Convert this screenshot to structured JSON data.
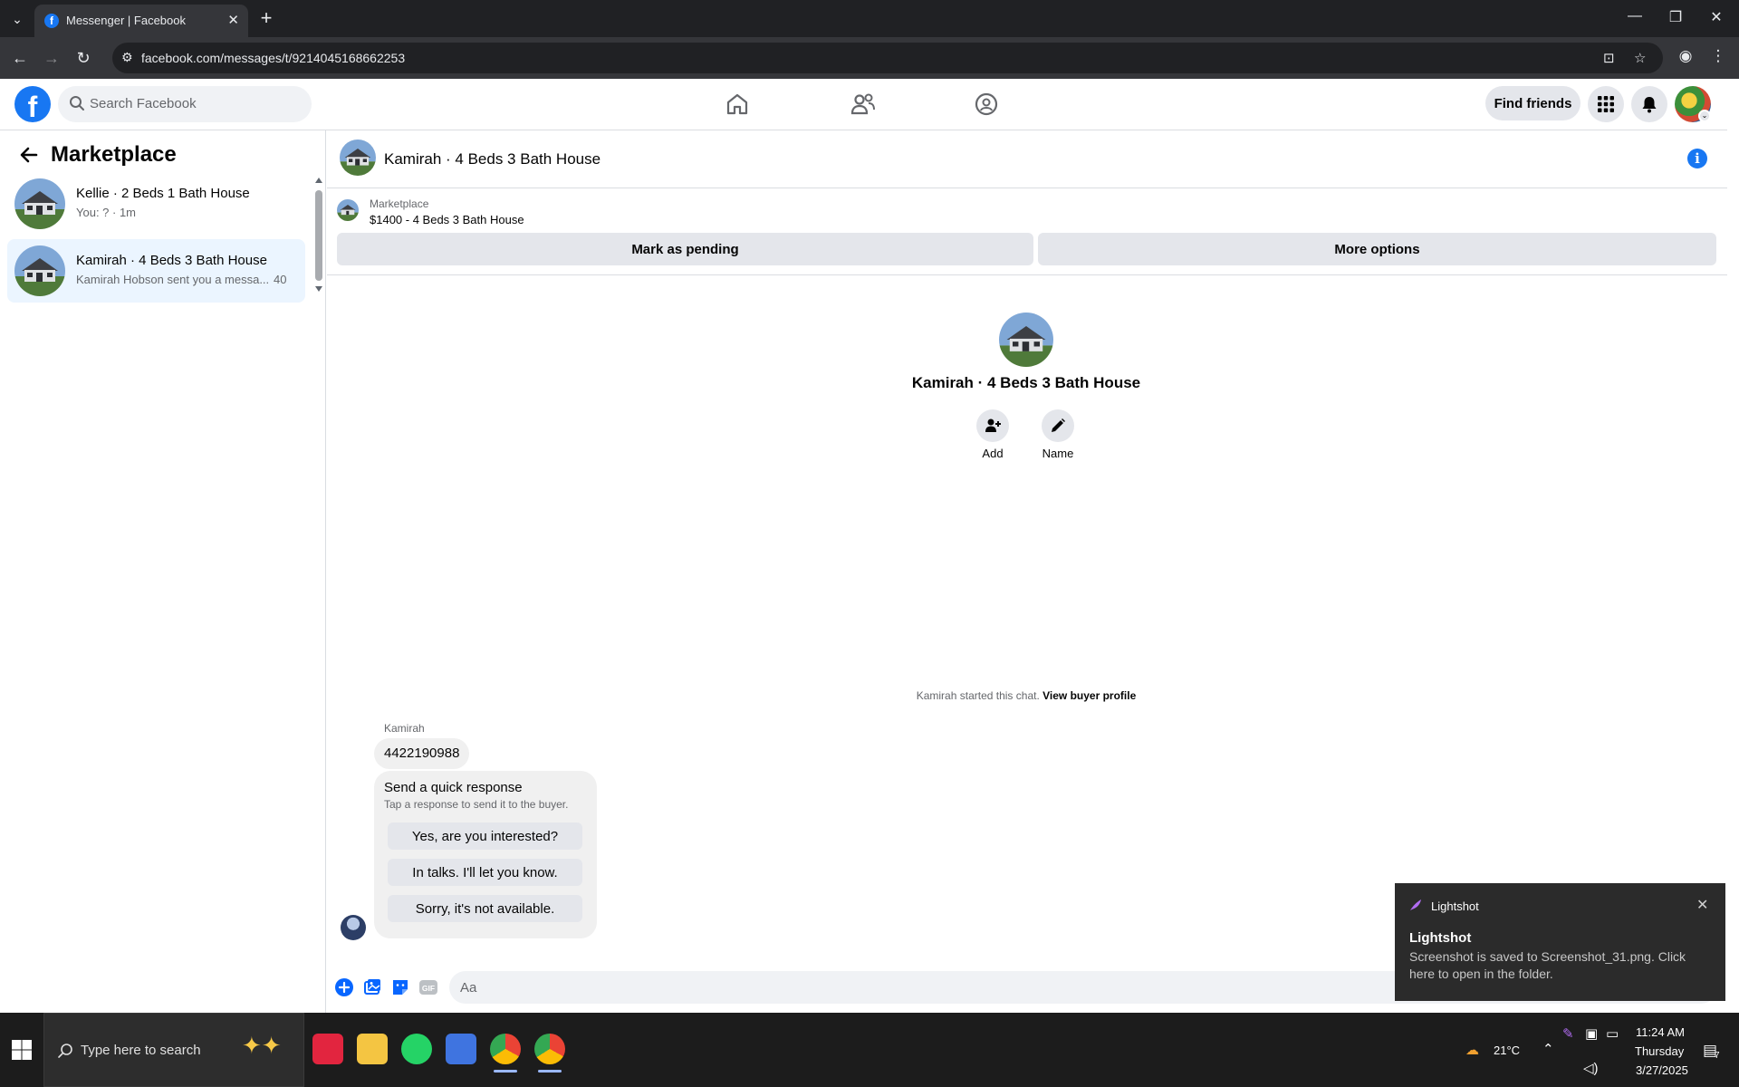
{
  "browser": {
    "tab_title": "Messenger | Facebook",
    "url": "facebook.com/messages/t/9214045168662253",
    "new_tab": "+",
    "tab_close": "✕",
    "tab_menu": "⌄",
    "minimize": "—",
    "restore": "❐",
    "close": "✕",
    "back": "←",
    "forward": "→",
    "reload": "↻",
    "site_info": "⚙",
    "install": "⊡",
    "bookmark": "☆",
    "profile": "◉",
    "menu": "⋮"
  },
  "fb_header": {
    "logo": "f",
    "search_placeholder": "Search Facebook",
    "find_friends": "Find friends"
  },
  "left_panel": {
    "title": "Marketplace",
    "conversations": [
      {
        "name": "Kellie · 2 Beds 1 Bath House",
        "preview": "You: ? · 1m",
        "time": ""
      },
      {
        "name": "Kamirah · 4 Beds 3 Bath House",
        "preview": "Kamirah Hobson sent you a messa...",
        "time": "40"
      }
    ]
  },
  "chat": {
    "title": "Kamirah · 4 Beds 3 Bath House",
    "listing_label": "Marketplace",
    "listing_price": "$1400 - 4 Beds 3 Bath House",
    "mark_pending": "Mark as pending",
    "more_options": "More options",
    "center_name": "Kamirah · 4 Beds 3 Bath House",
    "add_label": "Add",
    "name_label": "Name",
    "started_text": "Kamirah started this chat.",
    "view_buyer": "View buyer profile",
    "sender": "Kamirah",
    "message": "4422190988",
    "quick_title": "Send a quick response",
    "quick_sub": "Tap a response to send it to the buyer.",
    "quick_responses": [
      "Yes, are you interested?",
      "In talks. I'll let you know.",
      "Sorry, it's not available."
    ],
    "composer_placeholder": "Aa"
  },
  "toast": {
    "app": "Lightshot",
    "title": "Lightshot",
    "message": "Screenshot is saved to Screenshot_31.png. Click here to open in the folder.",
    "close": "✕"
  },
  "taskbar": {
    "search_placeholder": "Type here to search",
    "temperature": "21°C",
    "time": "11:24 AM",
    "day": "Thursday",
    "date": "3/27/2025",
    "notifications": "7"
  }
}
